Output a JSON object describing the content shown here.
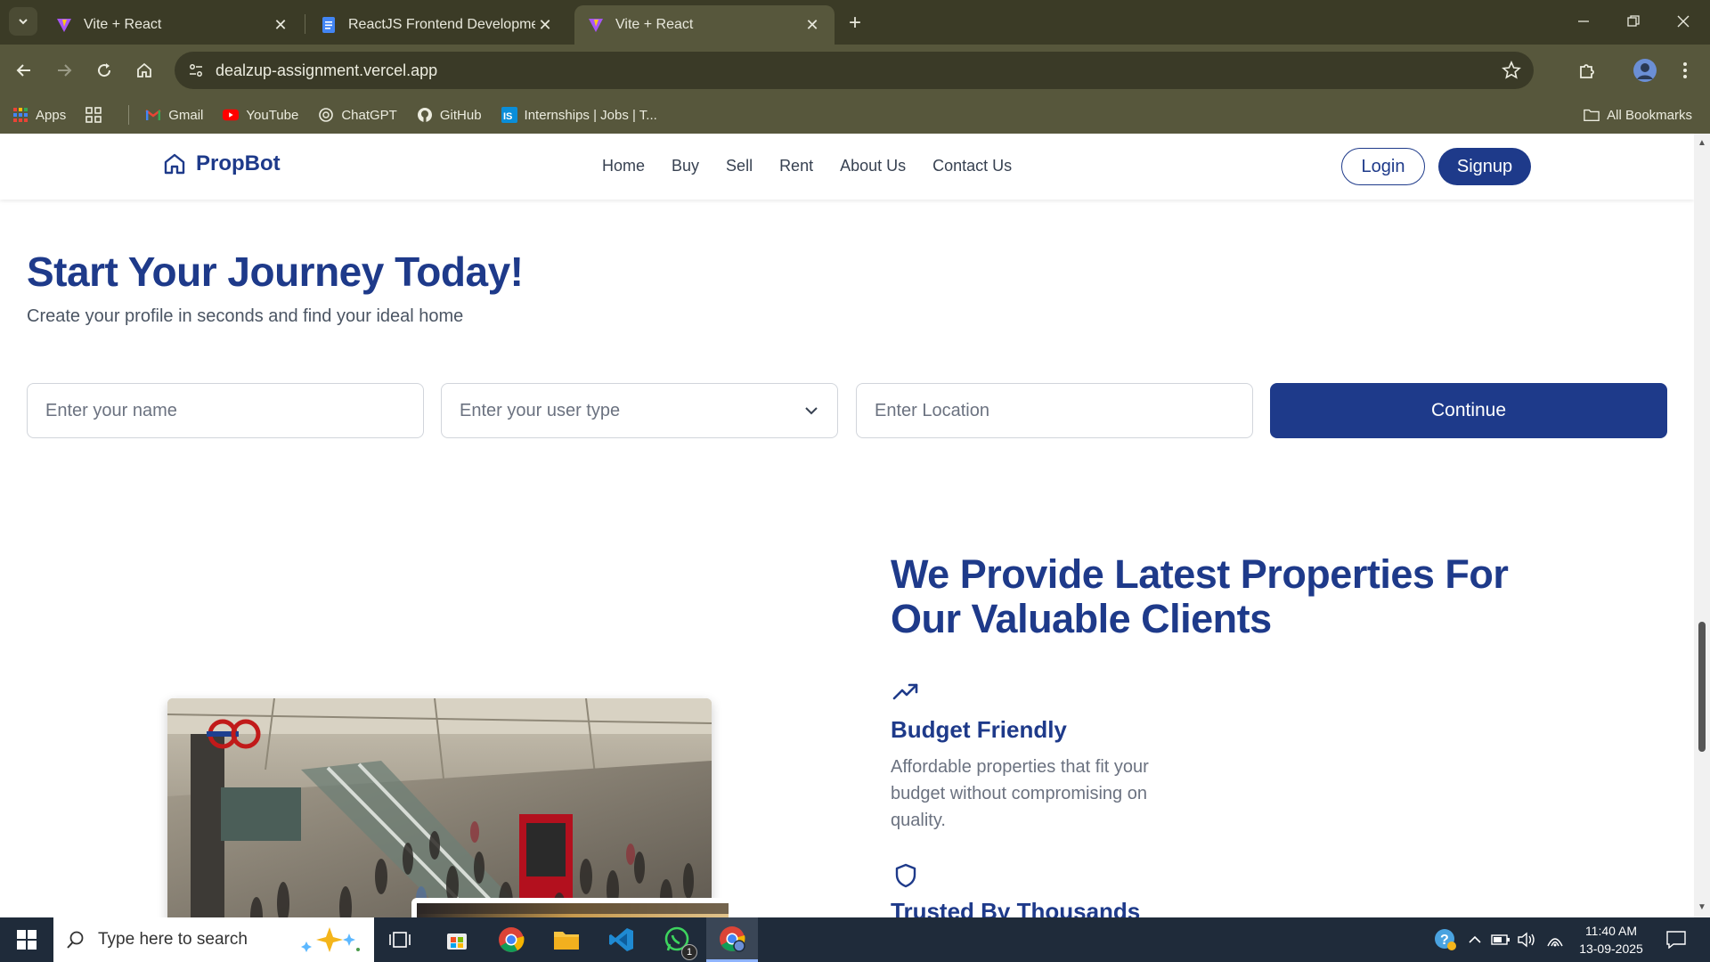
{
  "browser": {
    "tabs": [
      {
        "title": "Vite + React",
        "active": false
      },
      {
        "title": "ReactJS Frontend Development",
        "active": false
      },
      {
        "title": "Vite + React",
        "active": true
      }
    ],
    "url": "dealzup-assignment.vercel.app",
    "bookmarks": [
      {
        "label": "Apps",
        "icon": "apps-grid-icon"
      },
      {
        "label": "Gmail",
        "icon": "gmail-icon"
      },
      {
        "label": "YouTube",
        "icon": "youtube-icon"
      },
      {
        "label": "ChatGPT",
        "icon": "chatgpt-icon"
      },
      {
        "label": "GitHub",
        "icon": "github-icon"
      },
      {
        "label": "Internships | Jobs | T...",
        "icon": "internshala-icon"
      }
    ],
    "all_bookmarks": "All Bookmarks"
  },
  "site": {
    "brand": "PropBot",
    "nav": [
      "Home",
      "Buy",
      "Sell",
      "Rent",
      "About Us",
      "Contact Us"
    ],
    "login": "Login",
    "signup": "Signup",
    "accent": "#1e3a8a"
  },
  "hero": {
    "title": "Start Your Journey Today!",
    "subtitle": "Create your profile in seconds and find your ideal home",
    "name_placeholder": "Enter your name",
    "usertype_placeholder": "Enter your user type",
    "location_placeholder": "Enter Location",
    "continue": "Continue"
  },
  "features": {
    "title": "We Provide Latest Properties For Our Valuable Clients",
    "items": [
      {
        "icon": "trending-up-icon",
        "title": "Budget Friendly",
        "text": "Affordable properties that fit your budget without compromising on quality."
      },
      {
        "icon": "shield-icon",
        "title": "Trusted By Thousands",
        "text": ""
      }
    ]
  },
  "taskbar": {
    "search_placeholder": "Type here to search",
    "time": "11:40 AM",
    "date": "13-09-2025",
    "whatsapp_badge": "1"
  }
}
